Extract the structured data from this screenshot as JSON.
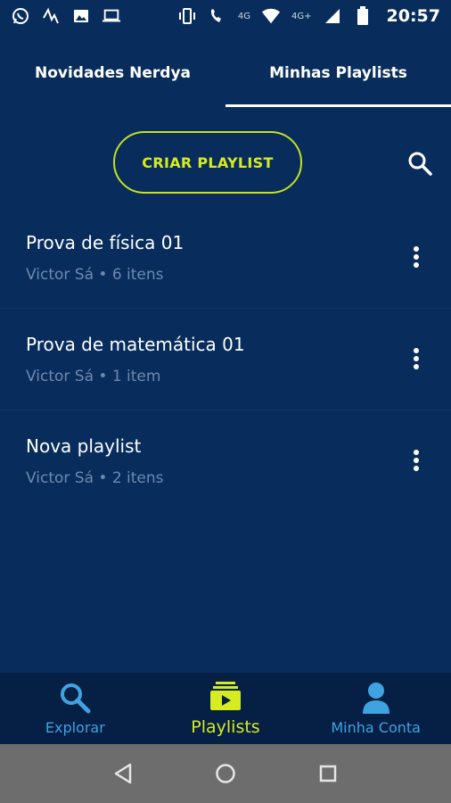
{
  "status_bar": {
    "time": "20:57",
    "network_primary": "4G",
    "network_secondary": "4G+",
    "icons_left": [
      "whatsapp-icon",
      "activity-icon",
      "image-icon",
      "laptop-icon"
    ],
    "icons_right": [
      "vibrate-icon",
      "wifi-call-icon",
      "wifi-icon",
      "signal-icon",
      "battery-icon"
    ]
  },
  "tabs": [
    {
      "label": "Novidades Nerdya",
      "active": false
    },
    {
      "label": "Minhas Playlists",
      "active": true
    }
  ],
  "actions": {
    "create_label": "CRIAR PLAYLIST",
    "search_icon": "search-icon"
  },
  "playlists": [
    {
      "title": "Prova de física 01",
      "subtitle": "Victor Sá • 6 itens"
    },
    {
      "title": "Prova de matemática 01",
      "subtitle": "Victor Sá • 1 item"
    },
    {
      "title": "Nova playlist",
      "subtitle": "Victor Sá • 2 itens"
    }
  ],
  "bottom_nav": [
    {
      "label": "Explorar",
      "icon": "search-icon",
      "active": false
    },
    {
      "label": "Playlists",
      "icon": "playlists-icon",
      "active": true
    },
    {
      "label": "Minha Conta",
      "icon": "user-icon",
      "active": false
    }
  ],
  "system_nav": [
    "back-icon",
    "home-icon",
    "recents-icon"
  ],
  "colors": {
    "background": "#082d5c",
    "bottom_nav_bg": "#061f44",
    "accent": "#d6ec1f",
    "nav_blue": "#3fa3e2",
    "subtitle": "#6f88ad",
    "system_nav_bg": "#6d6d6d"
  }
}
